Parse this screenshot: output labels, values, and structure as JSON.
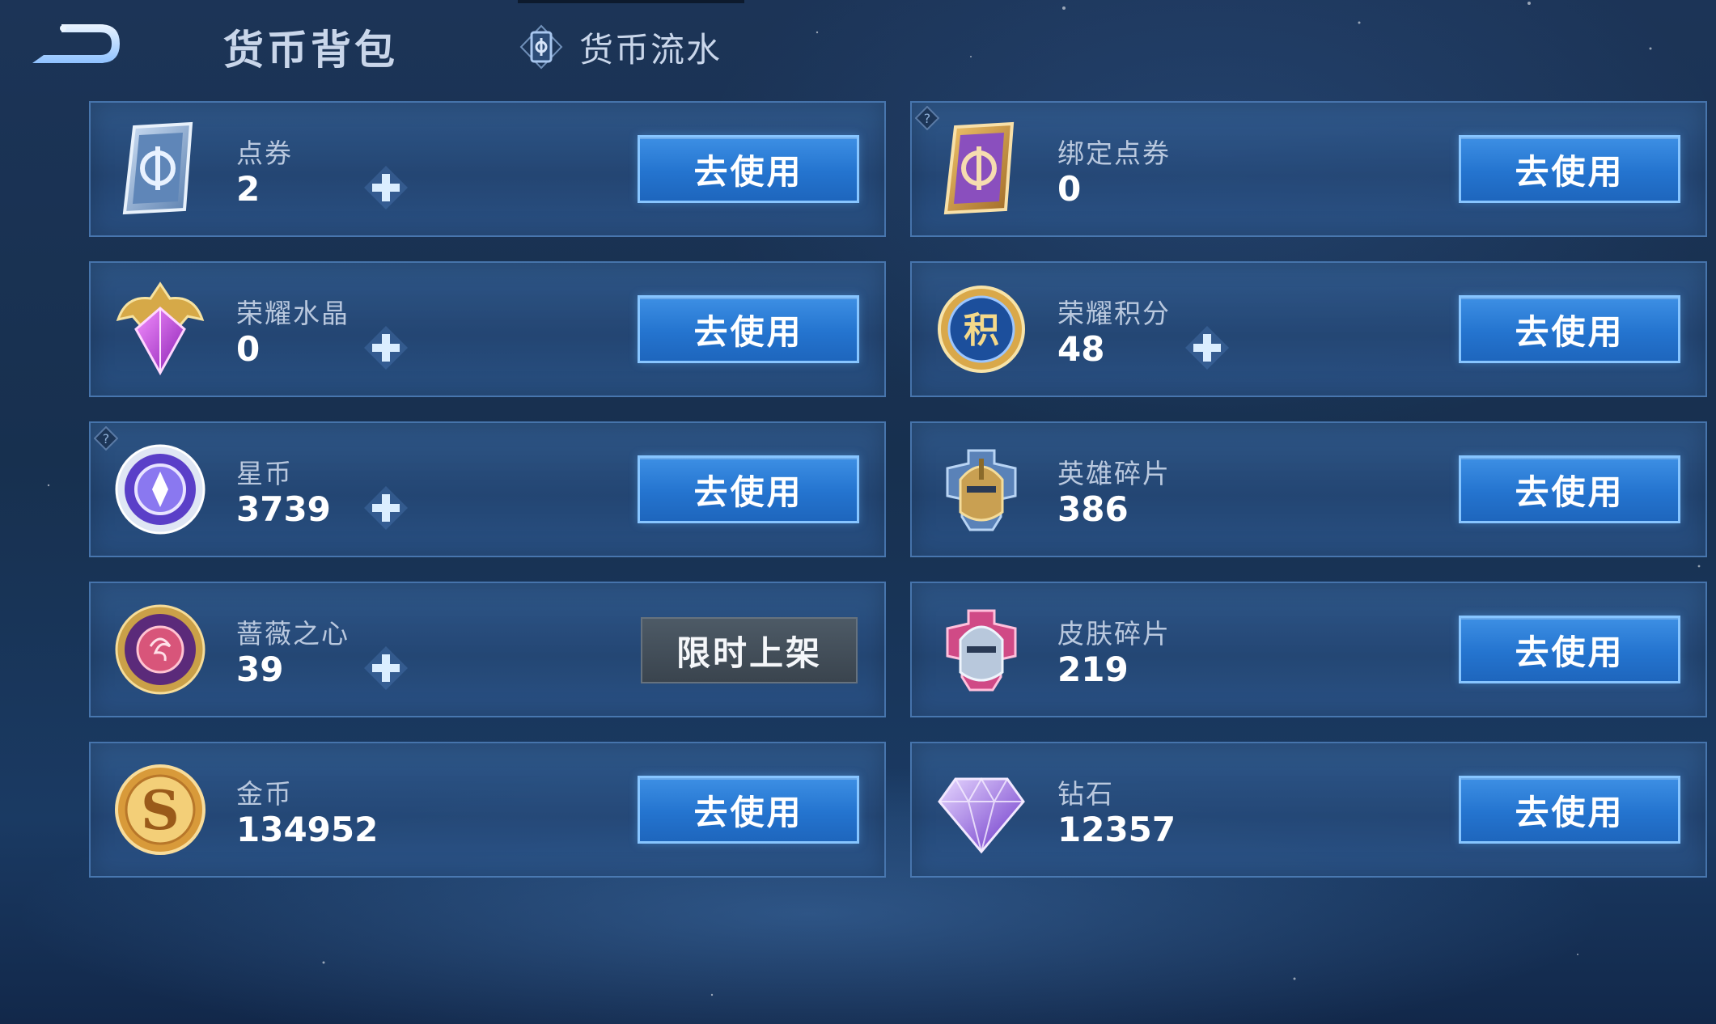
{
  "header": {
    "title": "货币背包",
    "flow_tab_label": "货币流水"
  },
  "button_labels": {
    "use": "去使用",
    "limited": "限时上架"
  },
  "currencies": [
    {
      "name": "点券",
      "value": "2",
      "icon": "ticket-blue-icon"
    },
    {
      "name": "绑定点券",
      "value": "0",
      "icon": "ticket-purple-icon"
    },
    {
      "name": "荣耀水晶",
      "value": "0",
      "icon": "glory-crystal-icon"
    },
    {
      "name": "荣耀积分",
      "value": "48",
      "icon": "glory-points-icon"
    },
    {
      "name": "星币",
      "value": "3739",
      "icon": "star-coin-icon"
    },
    {
      "name": "英雄碎片",
      "value": "386",
      "icon": "hero-shard-icon"
    },
    {
      "name": "蔷薇之心",
      "value": "39",
      "icon": "rose-heart-icon"
    },
    {
      "name": "皮肤碎片",
      "value": "219",
      "icon": "skin-shard-icon"
    },
    {
      "name": "金币",
      "value": "134952",
      "icon": "gold-coin-icon"
    },
    {
      "name": "钻石",
      "value": "12357",
      "icon": "diamond-icon"
    }
  ],
  "colors": {
    "button_blue": "#2474cf",
    "button_border": "#87c5ff",
    "limited_gray": "#3a444e",
    "card_bg": "#2d5a90"
  }
}
